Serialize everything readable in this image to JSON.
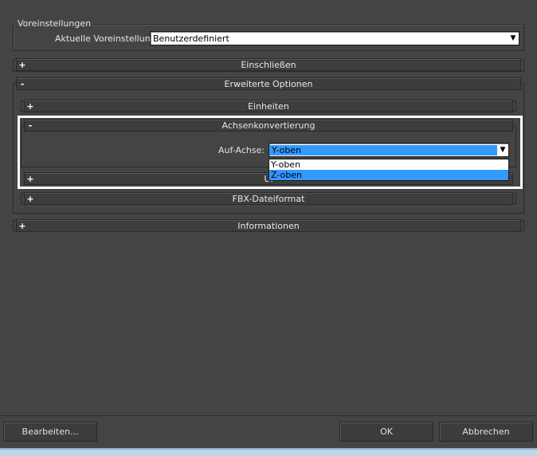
{
  "presets": {
    "group_title": "Voreinstellungen",
    "current_label": "Aktuelle Voreinstellung:",
    "current_value": "Benutzerdefiniert"
  },
  "rollouts": {
    "einschliessen": {
      "sign": "+",
      "title": "Einschließen"
    },
    "erweiterte": {
      "sign": "-",
      "title": "Erweiterte Optionen"
    },
    "einheiten": {
      "sign": "+",
      "title": "Einheiten"
    },
    "achsen": {
      "sign": "-",
      "title": "Achsenkonvertierung"
    },
    "ui": {
      "sign": "+",
      "title": "UI"
    },
    "fbx": {
      "sign": "+",
      "title": "FBX-Dateiformat"
    },
    "informationen": {
      "sign": "+",
      "title": "Informationen"
    }
  },
  "axis": {
    "label": "Auf-Achse:",
    "value": "Y-oben",
    "options": [
      "Y-oben",
      "Z-oben"
    ],
    "highlighted": "Z-oben"
  },
  "buttons": {
    "edit": "Bearbeiten...",
    "ok": "OK",
    "cancel": "Abbrechen"
  }
}
